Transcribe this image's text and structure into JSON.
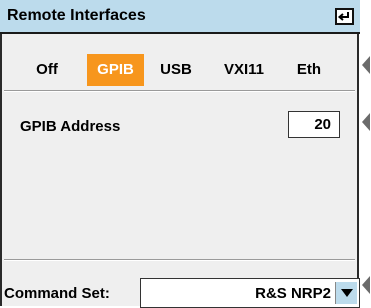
{
  "window": {
    "title": "Remote Interfaces",
    "enter_icon": "enter-icon"
  },
  "tabs": [
    {
      "label": "Off",
      "active": false
    },
    {
      "label": "GPIB",
      "active": true
    },
    {
      "label": "USB",
      "active": false
    },
    {
      "label": "VXI11",
      "active": false
    },
    {
      "label": "Eth",
      "active": false
    }
  ],
  "gpib": {
    "label": "GPIB Address",
    "value": "20"
  },
  "command_set": {
    "label": "Command Set:",
    "value": "R&S NRP2"
  },
  "colors": {
    "title_bar": "#bcdbec",
    "active_tab": "#f7961d",
    "panel": "#efefef"
  }
}
